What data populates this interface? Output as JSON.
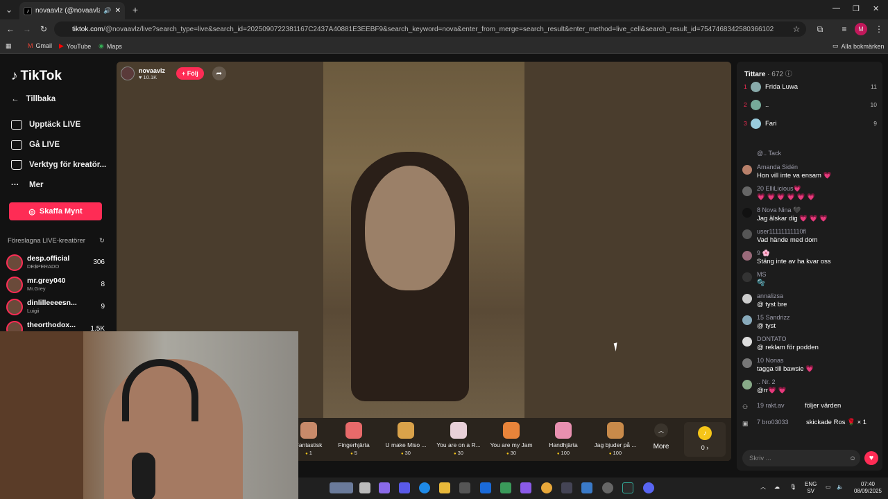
{
  "browser": {
    "tab_title": "novaavlz (@novaavlz) är LIVE",
    "tab_close": "✕",
    "new_tab": "+",
    "url_host": "tiktok.com",
    "url_path": "/@novaavlz/live?search_type=live&search_id=2025090722381167C2437A40881E3EEBF9&search_keyword=nova&enter_from_merge=search_result&enter_method=live_cell&search_result_id=7547468342580366102",
    "bookmarks": [
      "Gmail",
      "YouTube",
      "Maps"
    ],
    "all_bookmarks": "Alla bokmärken",
    "profile_initial": "M"
  },
  "sidebar": {
    "logo": "TikTok",
    "back": "Tillbaka",
    "nav": [
      "Upptäck LIVE",
      "Gå LIVE",
      "Verktyg för kreatör...",
      "Mer"
    ],
    "coins_button": "Skaffa Mynt",
    "suggested_title": "Föreslagna LIVE-kreatörer",
    "creators": [
      {
        "name": "desp.official",
        "sub": "DE$PERADO",
        "count": "306"
      },
      {
        "name": "mr.grey040",
        "sub": "Mr.Grey",
        "count": "8"
      },
      {
        "name": "dinlilleeeesn...",
        "sub": "Luigii",
        "count": "9"
      },
      {
        "name": "theorthodox...",
        "sub": "",
        "count": "1.5K"
      }
    ]
  },
  "stream": {
    "host_name": "novaavlz",
    "host_likes": "10.1K",
    "follow": "+ Följ",
    "gifts": [
      {
        "name": "Fantastisk",
        "price": "1"
      },
      {
        "name": "Fingerhjärta",
        "price": "5"
      },
      {
        "name": "U make Miso ...",
        "price": "30"
      },
      {
        "name": "You are on a R...",
        "price": "30"
      },
      {
        "name": "You are my Jam",
        "price": "30"
      },
      {
        "name": "Handhjärta",
        "price": "100"
      },
      {
        "name": "Jag bjuder på ...",
        "price": "100"
      }
    ],
    "more": "More",
    "coin_balance": "0 ›"
  },
  "chat": {
    "viewers_label": "Tittare",
    "viewers_count": "· 672",
    "ranking": [
      {
        "rank": "1",
        "name": "Frida Luwa",
        "count": "11"
      },
      {
        "rank": "2",
        "name": "..",
        "count": "10"
      },
      {
        "rank": "3",
        "name": "Fari",
        "count": "9"
      }
    ],
    "messages": [
      {
        "user": "@.. Tack",
        "text": ""
      },
      {
        "user": "Amanda Sidén",
        "text": "Hon vill inte va ensam 💗"
      },
      {
        "user": "20 ElliLicious💗",
        "text": "💗 💗 💗 💗 💗 💗"
      },
      {
        "user": "8 Nova Nina 🖤",
        "text": "Jag älskar dig 💗 💗 💗"
      },
      {
        "user": "user11111111110fl",
        "text": "Vad hände med dom"
      },
      {
        "user": "9 🌸",
        "text": "Stäng inte av ha kvar oss"
      },
      {
        "user": "MS",
        "text": "🫧"
      },
      {
        "user": "annalizsa",
        "text": "@ tyst bre"
      },
      {
        "user": "15 Sandrizz",
        "text": "@ tyst"
      },
      {
        "user": "DONTATO",
        "text": "@ reklam för podden"
      },
      {
        "user": "10 Nonas",
        "text": "tagga till bawsie 💗"
      },
      {
        "user": ".. Nr. 2",
        "text": "@rr💗 💗"
      },
      {
        "user": "19 rakt.av",
        "text": "följer värden"
      },
      {
        "user": "7 bro03033",
        "text": "skickade Ros 🌹 × 1"
      }
    ],
    "input_placeholder": "Skriv ..."
  },
  "taskbar": {
    "lang": "ENG",
    "lang_sub": "SV",
    "time": "07:40",
    "date": "08/09/2025"
  }
}
